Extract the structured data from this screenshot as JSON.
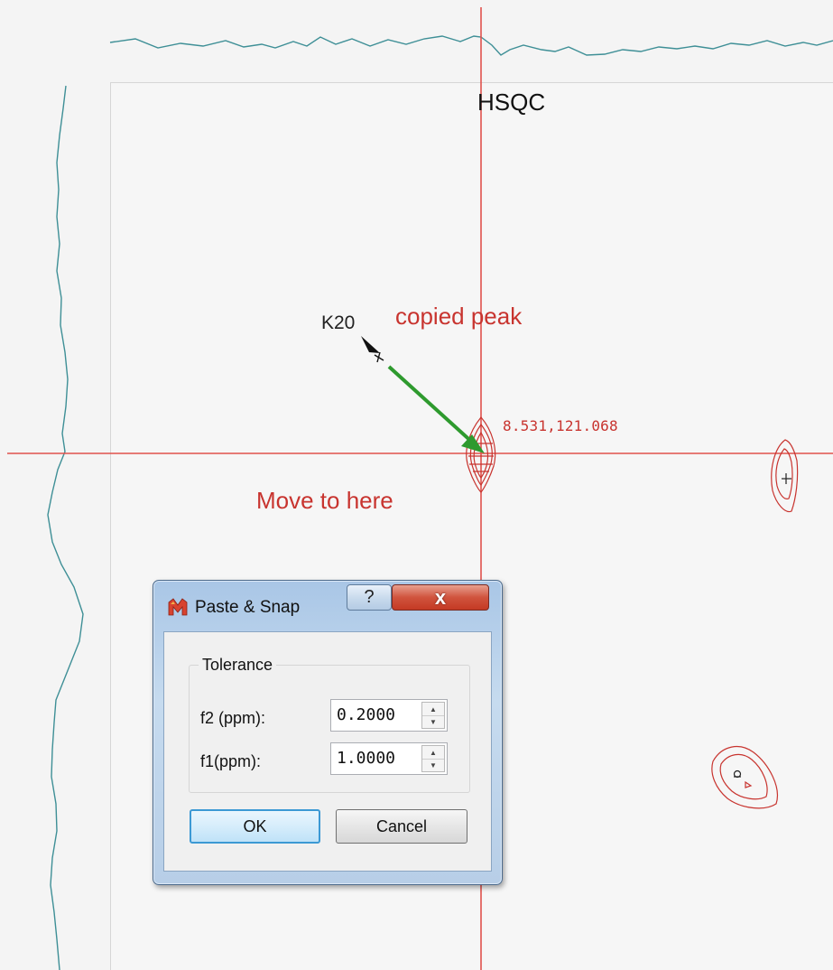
{
  "spectrum": {
    "title": "HSQC",
    "peak_label": "K20",
    "coordinate_readout": "8.531,121.068",
    "annotation_copied": "copied peak",
    "annotation_move": "Move to here",
    "colors": {
      "crosshair": "#e0524c",
      "contour": "#c8342f",
      "projection": "#3e8f96",
      "arrow": "#2e9a2e"
    }
  },
  "dialog": {
    "title": "Paste & Snap",
    "help_glyph": "?",
    "close_glyph": "x",
    "app_icon": "mnova-icon",
    "group_title": "Tolerance",
    "fields": [
      {
        "label": "f2 (ppm):",
        "value": "0.2000"
      },
      {
        "label": "f1(ppm):",
        "value": "1.0000"
      }
    ],
    "ok_label": "OK",
    "cancel_label": "Cancel"
  }
}
